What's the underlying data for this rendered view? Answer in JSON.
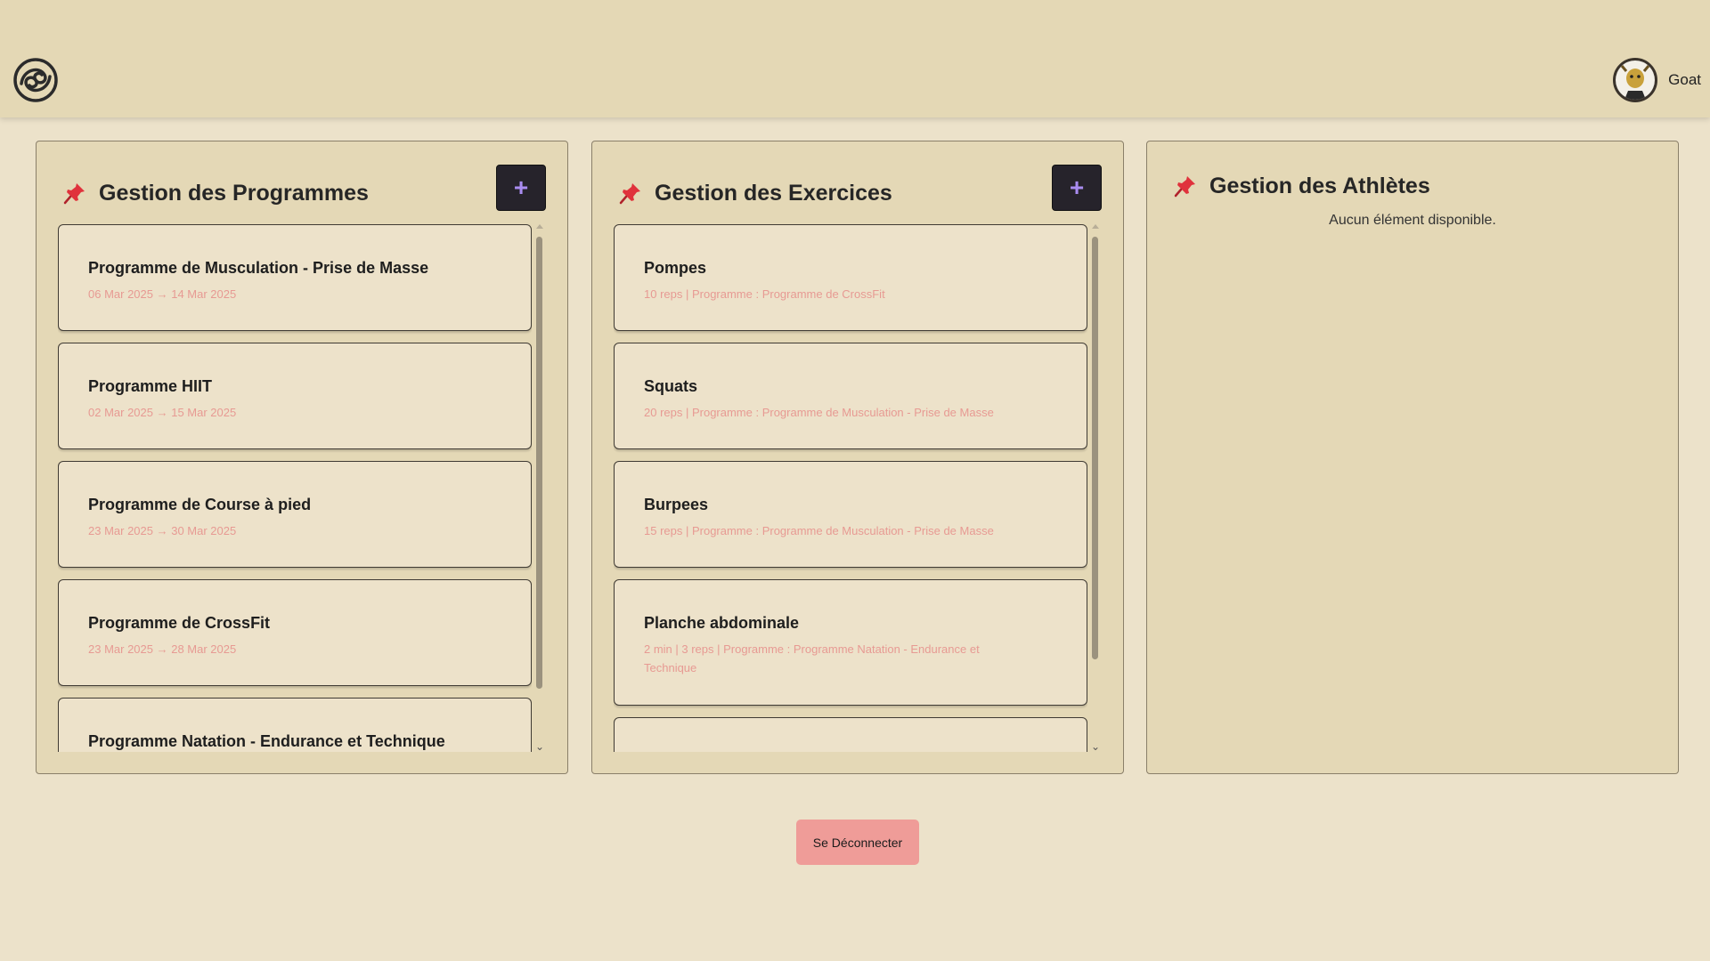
{
  "header": {
    "logo_icon": "swirl-logo-icon",
    "user": {
      "name": "Goat",
      "avatar_icon": "goat-avatar-icon"
    }
  },
  "programmes": {
    "title": "Gestion des Programmes",
    "icon": "pushpin-icon",
    "add_label": "+",
    "items": [
      {
        "title": "Programme de Musculation - Prise de Masse",
        "sub": "06 Mar 2025 → 14 Mar 2025"
      },
      {
        "title": "Programme HIIT",
        "sub": "02 Mar 2025 → 15 Mar 2025"
      },
      {
        "title": "Programme de Course à pied",
        "sub": "23 Mar 2025 → 30 Mar 2025"
      },
      {
        "title": "Programme de CrossFit",
        "sub": "23 Mar 2025 → 28 Mar 2025"
      },
      {
        "title": "Programme Natation - Endurance et Technique",
        "sub": ""
      }
    ]
  },
  "exercices": {
    "title": "Gestion des Exercices",
    "icon": "pushpin-icon",
    "add_label": "+",
    "items": [
      {
        "title": "Pompes",
        "sub": "10 reps | Programme : Programme de CrossFit"
      },
      {
        "title": "Squats",
        "sub": "20 reps | Programme : Programme de Musculation - Prise de Masse"
      },
      {
        "title": "Burpees",
        "sub": "15 reps | Programme : Programme de Musculation - Prise de Masse"
      },
      {
        "title": "Planche abdominale",
        "sub": "2 min | 3 reps | Programme : Programme Natation - Endurance et Technique"
      },
      {
        "title": "",
        "sub": ""
      }
    ]
  },
  "athletes": {
    "title": "Gestion des Athlètes",
    "icon": "pushpin-icon",
    "empty_text": "Aucun élément disponible."
  },
  "logout_label": "Se Déconnecter",
  "colors": {
    "background": "#ece2ca",
    "panel": "#e4d8b6",
    "card_subtext": "#e79a93",
    "add_button": "#26232b",
    "add_button_plus": "#a98cf0",
    "logout_button": "#ef9c98",
    "pin": "#e0323c"
  }
}
